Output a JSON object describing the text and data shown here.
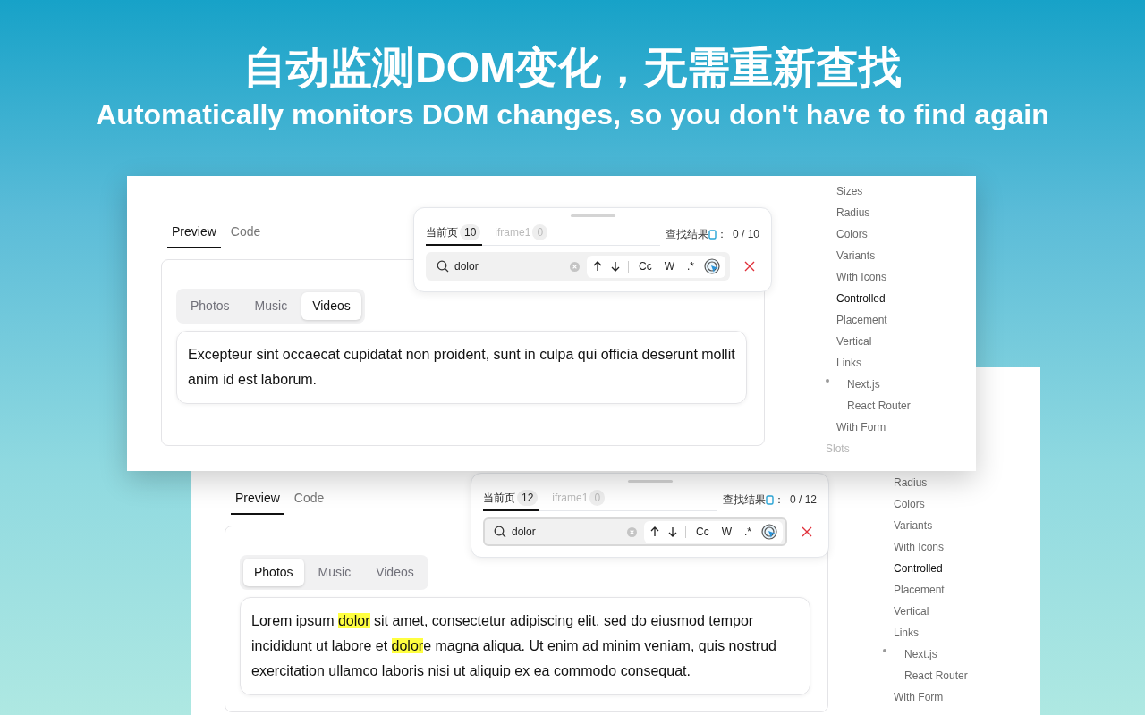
{
  "headline": {
    "title": "自动监测DOM变化，无需重新查找",
    "subtitle": "Automatically monitors DOM changes, so you don't have to find again"
  },
  "screenshots": [
    {
      "view_tabs": [
        {
          "label": "Preview",
          "selected": true
        },
        {
          "label": "Code",
          "selected": false
        }
      ],
      "segments": [
        {
          "label": "Photos",
          "selected": false
        },
        {
          "label": "Music",
          "selected": false
        },
        {
          "label": "Videos",
          "selected": true
        }
      ],
      "paragraph": [
        {
          "text": "Excepteur sint occaecat cupidatat non proident, sunt in culpa qui officia deserunt mollit anim id est laborum.",
          "highlighted": false
        }
      ],
      "find_panel": {
        "tabs": [
          {
            "label": "当前页",
            "count": "10",
            "selected": true
          },
          {
            "label": "iframe1",
            "count": "0",
            "selected": false
          }
        ],
        "result_label": "查找结果",
        "result_colon": "：",
        "result": "0 / 10",
        "query": "dolor",
        "focused": false,
        "options": [
          "Cc",
          "W",
          ".*"
        ]
      },
      "sidebar": [
        {
          "label": "Sizes",
          "kind": "item",
          "selected": false
        },
        {
          "label": "Radius",
          "kind": "item",
          "selected": false
        },
        {
          "label": "Colors",
          "kind": "item",
          "selected": false
        },
        {
          "label": "Variants",
          "kind": "item",
          "selected": false
        },
        {
          "label": "With Icons",
          "kind": "item",
          "selected": false
        },
        {
          "label": "Controlled",
          "kind": "item",
          "selected": true
        },
        {
          "label": "Placement",
          "kind": "item",
          "selected": false
        },
        {
          "label": "Vertical",
          "kind": "item",
          "selected": false
        },
        {
          "label": "Links",
          "kind": "item",
          "selected": false,
          "children": [
            {
              "label": "Next.js",
              "marked": true
            },
            {
              "label": "React Router",
              "marked": false
            }
          ]
        },
        {
          "label": "With Form",
          "kind": "item",
          "selected": false
        },
        {
          "label": "Slots",
          "kind": "section"
        }
      ]
    },
    {
      "view_tabs": [
        {
          "label": "Preview",
          "selected": true
        },
        {
          "label": "Code",
          "selected": false
        }
      ],
      "segments": [
        {
          "label": "Photos",
          "selected": true
        },
        {
          "label": "Music",
          "selected": false
        },
        {
          "label": "Videos",
          "selected": false
        }
      ],
      "paragraph": [
        {
          "text": "Lorem ipsum ",
          "highlighted": false
        },
        {
          "text": "dolor",
          "highlighted": true
        },
        {
          "text": " sit amet, consectetur adipiscing elit, sed do eiusmod tempor incididunt ut labore et ",
          "highlighted": false
        },
        {
          "text": "dolor",
          "highlighted": true
        },
        {
          "text": "e magna aliqua. Ut enim ad minim veniam, quis nostrud exercitation ullamco laboris nisi ut aliquip ex ea commodo consequat.",
          "highlighted": false
        }
      ],
      "find_panel": {
        "tabs": [
          {
            "label": "当前页",
            "count": "12",
            "selected": true
          },
          {
            "label": "iframe1",
            "count": "0",
            "selected": false
          }
        ],
        "result_label": "查找结果",
        "result_colon": "：",
        "result": "0 / 12",
        "query": "dolor",
        "focused": true,
        "options": [
          "Cc",
          "W",
          ".*"
        ]
      },
      "sidebar": [
        {
          "label": "Radius",
          "kind": "item",
          "selected": false
        },
        {
          "label": "Colors",
          "kind": "item",
          "selected": false
        },
        {
          "label": "Variants",
          "kind": "item",
          "selected": false
        },
        {
          "label": "With Icons",
          "kind": "item",
          "selected": false
        },
        {
          "label": "Controlled",
          "kind": "item",
          "selected": true
        },
        {
          "label": "Placement",
          "kind": "item",
          "selected": false
        },
        {
          "label": "Vertical",
          "kind": "item",
          "selected": false
        },
        {
          "label": "Links",
          "kind": "item",
          "selected": false,
          "children": [
            {
              "label": "Next.js",
              "marked": true
            },
            {
              "label": "React Router",
              "marked": false
            }
          ]
        },
        {
          "label": "With Form",
          "kind": "item",
          "selected": false
        }
      ]
    }
  ]
}
